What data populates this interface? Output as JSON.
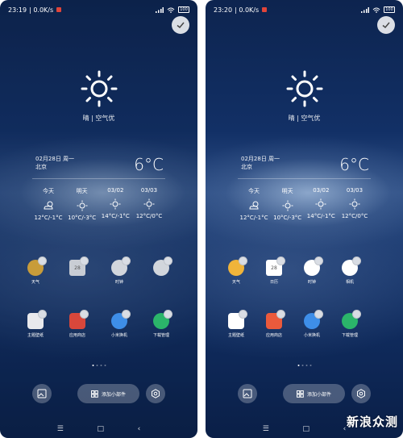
{
  "left": {
    "status": {
      "time": "23:19",
      "speed": "0.0K/s",
      "battery": "100"
    },
    "weather": {
      "condition": "晴 | 空气优",
      "date": "02月28日 周一",
      "city": "北京",
      "temp": "6°C"
    },
    "forecast": [
      {
        "label": "今天",
        "range": "12°C/-1°C",
        "icon": "cloud-sun-icon"
      },
      {
        "label": "明天",
        "range": "10°C/-3°C",
        "icon": "sun-icon"
      },
      {
        "label": "03/02",
        "range": "14°C/-1°C",
        "icon": "sun-icon"
      },
      {
        "label": "03/03",
        "range": "12°C/0°C",
        "icon": "sun-icon"
      }
    ],
    "apps": [
      {
        "label": "天气",
        "color": "#c89c3a"
      },
      {
        "label": "",
        "color": "#c9cdd4",
        "text": "28"
      },
      {
        "label": "时钟",
        "color": "#d2d6dc"
      },
      {
        "label": "",
        "color": "#d2d6dc"
      },
      {
        "label": "主题壁纸",
        "color": "#e9e9ec"
      },
      {
        "label": "应用商店",
        "color": "#d8473b"
      },
      {
        "label": "小米换机",
        "color": "#3e8ee8"
      },
      {
        "label": "下载管理",
        "color": "#2bb56a"
      }
    ],
    "widget_label": "添加小部件"
  },
  "right": {
    "status": {
      "time": "23:20",
      "speed": "0.0K/s",
      "battery": "100"
    },
    "weather": {
      "condition": "晴 | 空气优",
      "date": "02月28日 周一",
      "city": "北京",
      "temp": "6°C"
    },
    "forecast": [
      {
        "label": "今天",
        "range": "12°C/-1°C",
        "icon": "cloud-sun-icon"
      },
      {
        "label": "明天",
        "range": "10°C/-3°C",
        "icon": "sun-icon"
      },
      {
        "label": "03/02",
        "range": "14°C/-1°C",
        "icon": "sun-icon"
      },
      {
        "label": "03/03",
        "range": "12°C/0°C",
        "icon": "sun-icon"
      }
    ],
    "apps": [
      {
        "label": "天气",
        "color": "#f0b43a"
      },
      {
        "label": "日历",
        "color": "#ffffff",
        "text": "28"
      },
      {
        "label": "时钟",
        "color": "#ffffff"
      },
      {
        "label": "相机",
        "color": "#ffffff"
      },
      {
        "label": "主题壁纸",
        "color": "#ffffff"
      },
      {
        "label": "应用商店",
        "color": "#ea5a3c"
      },
      {
        "label": "小米换机",
        "color": "#3e8ee8"
      },
      {
        "label": "下载管理",
        "color": "#2bb56a"
      }
    ],
    "widget_label": "添加小部件"
  },
  "watermark": "新浪众测"
}
